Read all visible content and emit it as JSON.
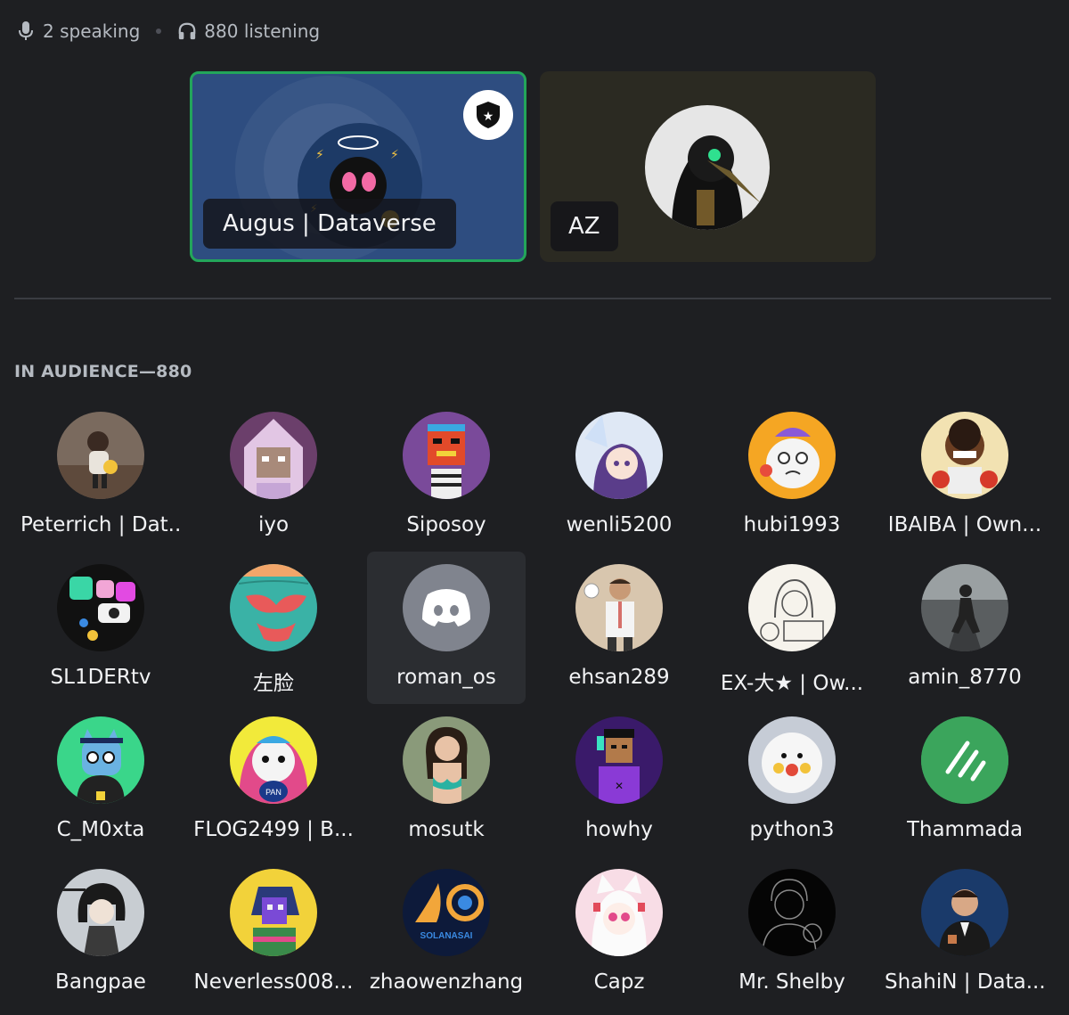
{
  "header": {
    "speaking_text": "2 speaking",
    "listening_text": "880 listening"
  },
  "speakers": [
    {
      "name": "Augus | Dataverse",
      "is_speaking": true,
      "is_moderator": true,
      "colors": {
        "bg": "#2e4d80",
        "ring": "#23a55a"
      }
    },
    {
      "name": "AZ",
      "is_speaking": false,
      "is_moderator": false,
      "colors": {
        "bg": "#2b2a22"
      }
    }
  ],
  "audience": {
    "heading": "IN AUDIENCE—880",
    "members": [
      {
        "name": "Peterrich | Dat...",
        "avatar": "photo-child-avatar"
      },
      {
        "name": "iyo",
        "avatar": "pixel-character-avatar"
      },
      {
        "name": "Siposoy",
        "avatar": "robot-head-avatar"
      },
      {
        "name": "wenli5200",
        "avatar": "anime-girl-avatar"
      },
      {
        "name": "hubi1993",
        "avatar": "cartoon-creature-avatar"
      },
      {
        "name": "IBAIBA | Own...",
        "avatar": "cartoon-boxer-avatar"
      },
      {
        "name": "SL1DERtv",
        "avatar": "collage-avatar"
      },
      {
        "name": "左脸",
        "avatar": "swimsuit-photo-avatar"
      },
      {
        "name": "roman_os",
        "avatar": "discord-default-avatar",
        "hovered": true
      },
      {
        "name": "ehsan289",
        "avatar": "man-photo-avatar"
      },
      {
        "name": "EX-大★ | Ow...",
        "avatar": "sketch-girl-avatar"
      },
      {
        "name": "amin_8770",
        "avatar": "runner-photo-avatar"
      },
      {
        "name": "C_M0xta",
        "avatar": "blue-cat-avatar"
      },
      {
        "name": "FLOG2499 | B...",
        "avatar": "penguin-avatar"
      },
      {
        "name": "mosutk",
        "avatar": "woman-photo-avatar"
      },
      {
        "name": "howhy",
        "avatar": "pixel-person-avatar"
      },
      {
        "name": "python3",
        "avatar": "white-dog-avatar"
      },
      {
        "name": "Thammada",
        "avatar": "green-slash-avatar"
      },
      {
        "name": "Bangpae",
        "avatar": "cyber-girl-avatar"
      },
      {
        "name": "Neverless008...",
        "avatar": "hooded-pixel-avatar"
      },
      {
        "name": "zhaowenzhang",
        "avatar": "solana-logo-avatar"
      },
      {
        "name": "Capz",
        "avatar": "anime-cat-girl-avatar"
      },
      {
        "name": "Mr. Shelby",
        "avatar": "silhouette-avatar"
      },
      {
        "name": "ShahiN | Data...",
        "avatar": "man-suit-avatar"
      }
    ]
  },
  "colors": {
    "background": "#1e1f22",
    "speaking_ring": "#23a55a",
    "hover_bg": "#2b2d31",
    "discord_blurple_grey": "#80848e"
  }
}
